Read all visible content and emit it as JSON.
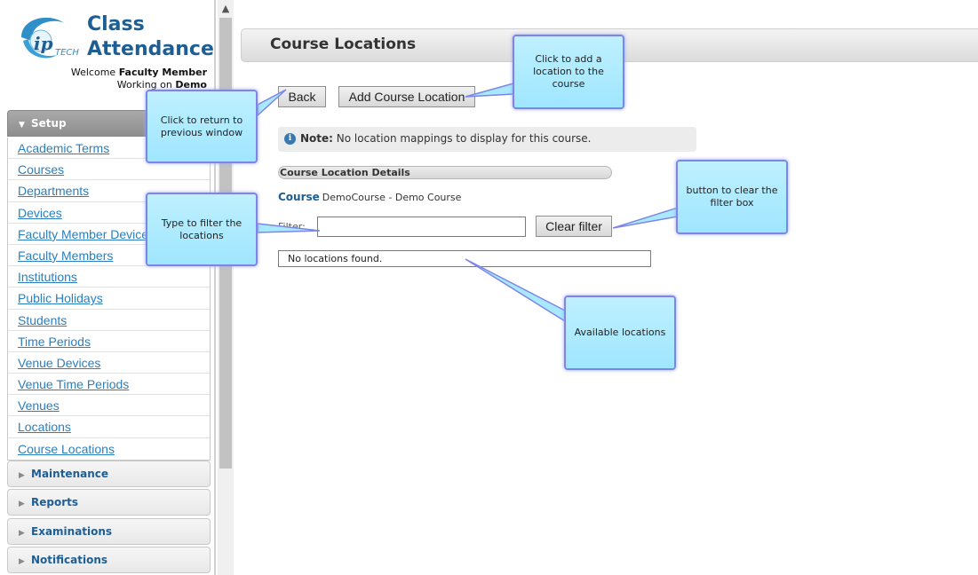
{
  "app": {
    "title_line1": "Class",
    "title_line2": "Attendance",
    "logo_text": "TECH",
    "welcome_prefix": "Welcome",
    "user_name": "Faculty Member",
    "working_prefix": "Working on",
    "working_on": "Demo"
  },
  "sidebar": {
    "setup_label": "Setup",
    "items": [
      {
        "label": "Academic Terms"
      },
      {
        "label": "Courses"
      },
      {
        "label": "Departments"
      },
      {
        "label": "Devices"
      },
      {
        "label": "Faculty Member Devices"
      },
      {
        "label": "Faculty Members"
      },
      {
        "label": "Institutions"
      },
      {
        "label": "Public Holidays"
      },
      {
        "label": "Students"
      },
      {
        "label": "Time Periods"
      },
      {
        "label": "Venue Devices"
      },
      {
        "label": "Venue Time Periods"
      },
      {
        "label": "Venues"
      },
      {
        "label": "Locations"
      },
      {
        "label": "Course Locations"
      }
    ],
    "sections": [
      {
        "label": "Maintenance"
      },
      {
        "label": "Reports"
      },
      {
        "label": "Examinations"
      },
      {
        "label": "Notifications"
      }
    ]
  },
  "main": {
    "page_title": "Course Locations",
    "back_label": "Back",
    "add_label": "Add Course Location",
    "note_label": "Note:",
    "note_text": "No location mappings to display for this course.",
    "section_title": "Course Location Details",
    "course_label": "Course",
    "course_value": "DemoCourse - Demo Course",
    "filter_label": "Filter:",
    "filter_value": "",
    "clear_filter_label": "Clear filter",
    "empty_message": "No locations found."
  },
  "callouts": {
    "add": "Click to add a location to the course",
    "back": "Click to return to previous window",
    "filter": "Type to filter the locations",
    "clear": "button to clear the filter box",
    "available": "Available locations"
  },
  "colors": {
    "brand": "#1e5e93",
    "link": "#2a7fbf",
    "callout_fill": "#b3ecff",
    "callout_border": "#7c86e8"
  }
}
